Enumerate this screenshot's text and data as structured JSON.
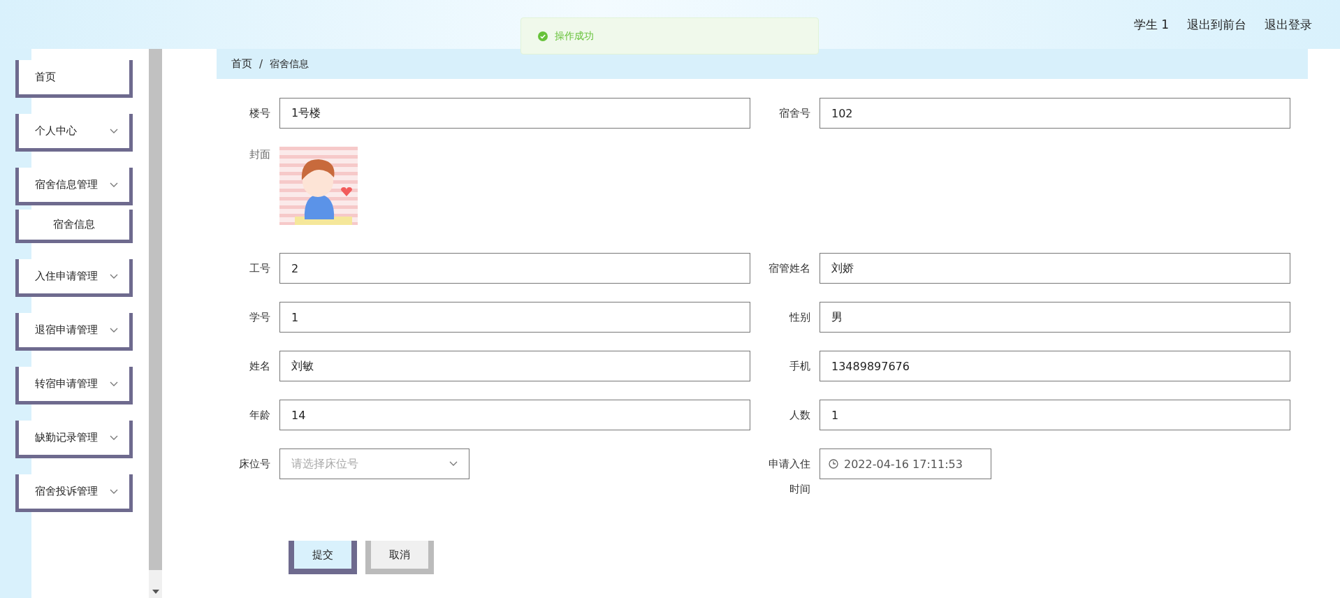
{
  "header": {
    "links": [
      "学生 1",
      "退出到前台",
      "退出登录"
    ]
  },
  "toast": {
    "kind": "success",
    "message": "操作成功"
  },
  "sidebar": {
    "items": [
      {
        "label": "首页",
        "kind": "link"
      },
      {
        "label": "个人中心",
        "kind": "menu"
      },
      {
        "label": "宿舍信息管理",
        "kind": "menu"
      },
      {
        "label": "宿舍信息",
        "kind": "submenu"
      },
      {
        "label": "入住申请管理",
        "kind": "menu"
      },
      {
        "label": "退宿申请管理",
        "kind": "menu"
      },
      {
        "label": "转宿申请管理",
        "kind": "menu"
      },
      {
        "label": "缺勤记录管理",
        "kind": "menu"
      },
      {
        "label": "宿舍投诉管理",
        "kind": "menu"
      }
    ]
  },
  "breadcrumb": {
    "items": [
      "首页",
      "宿舍信息"
    ],
    "separator": "/"
  },
  "form": {
    "rows": [
      [
        {
          "label": "楼号",
          "kind": "input",
          "value": "1号楼"
        },
        {
          "label": "宿舍号",
          "kind": "input",
          "value": "102"
        }
      ],
      [
        {
          "label": "封面"
        }
      ],
      [
        {
          "label": "工号",
          "kind": "input",
          "value": "2"
        },
        {
          "label": "宿管姓名",
          "kind": "input",
          "value": "刘娇"
        }
      ],
      [
        {
          "label": "学号",
          "kind": "input",
          "value": "1"
        },
        {
          "label": "性别",
          "kind": "input",
          "value": "男"
        }
      ],
      [
        {
          "label": "姓名",
          "kind": "input",
          "value": "刘敏"
        },
        {
          "label": "手机",
          "kind": "input",
          "value": "13489897676"
        }
      ],
      [
        {
          "label": "年龄",
          "kind": "input",
          "value": "14"
        },
        {
          "label": "人数",
          "kind": "input",
          "value": "1"
        }
      ],
      [
        {
          "label": "床位号",
          "kind": "select",
          "placeholder": "请选择床位号"
        },
        {
          "label": "申请入住时间",
          "kind": "datetime",
          "value": "2022-04-16 17:11:53"
        }
      ]
    ],
    "buttons": [
      {
        "label": "提交",
        "kind": "primary"
      },
      {
        "label": "取消",
        "kind": "secondary"
      }
    ]
  }
}
